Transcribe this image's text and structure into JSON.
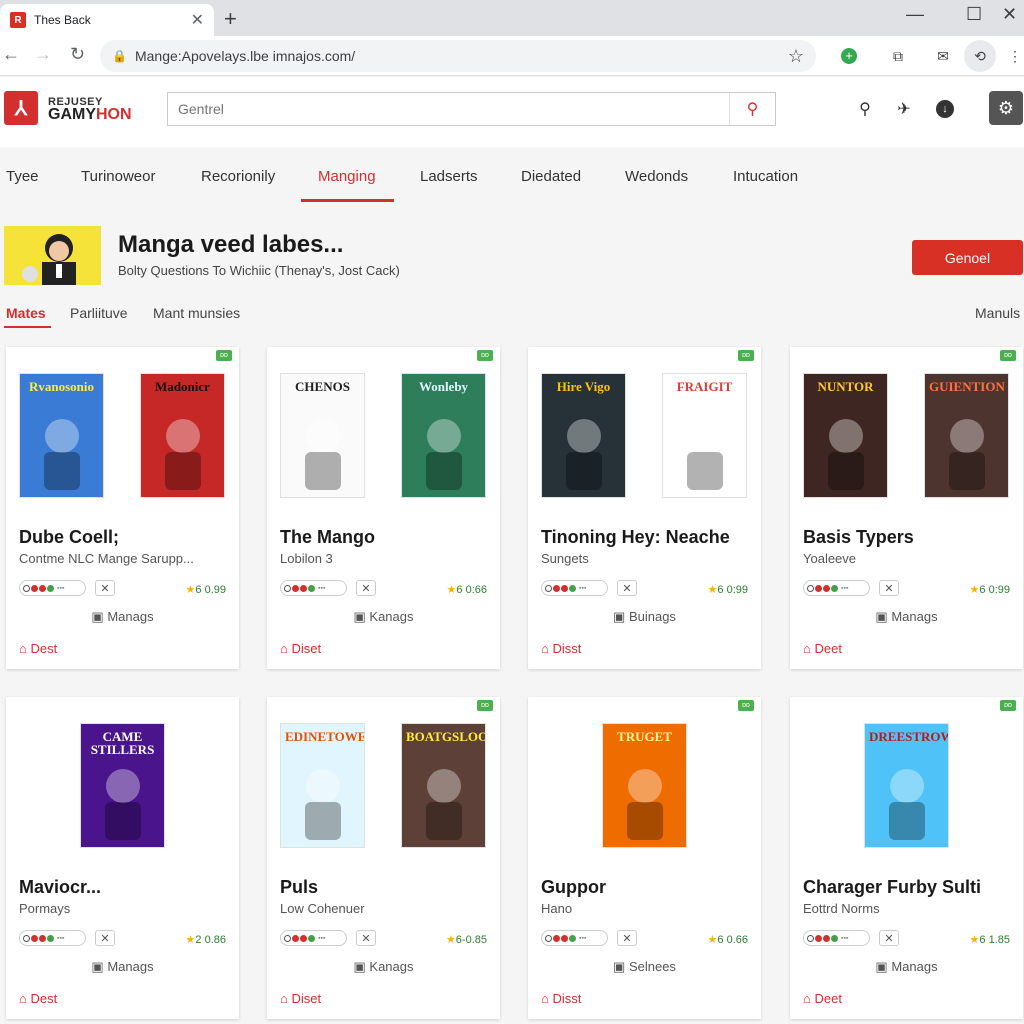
{
  "browser": {
    "tab_title": "Thes Back",
    "tab_icon": "r-logo-icon",
    "url": "Mange:Apovelays.lbe imnajos.com/"
  },
  "site": {
    "logo_top": "REJUSEY",
    "logo_bottom_a": "GAMY",
    "logo_bottom_b": "HON",
    "search_placeholder": "Gentrel",
    "brand_color": "#d32f2f"
  },
  "nav": {
    "items": [
      "Tyee",
      "Turinoweor",
      "Recorionily",
      "Manging",
      "Ladserts",
      "Diedated",
      "Wedonds",
      "Intucation"
    ],
    "active": "Manging"
  },
  "banner": {
    "title": "Manga veed labes...",
    "subtitle": "Bolty Questions To Wichiic (Thenay's, Jost Cack)",
    "cta": "Genoel"
  },
  "subtabs": {
    "items": [
      "Mates",
      "Parliituve",
      "Mant munsies"
    ],
    "right": "Manuls"
  },
  "cards": [
    {
      "title": "Dube Coell;",
      "subtitle": "Contme NLC Mange Sarupp...",
      "rating": "6 0.99",
      "meta": "Manags",
      "action": "Dest",
      "badge": "ᴅᴅ",
      "covers": [
        {
          "label": "Rvanosonio",
          "bg": "#3a7bd5",
          "fg": "#ffeb3b"
        },
        {
          "label": "Madonicr",
          "bg": "#c62828",
          "fg": "#111111"
        }
      ]
    },
    {
      "title": "The Mango",
      "subtitle": "Lobilon 3",
      "rating": "6 0:66",
      "meta": "Kanags",
      "action": "Diset",
      "badge": "ᴅᴅ",
      "covers": [
        {
          "label": "CHENOS",
          "bg": "#fafafa",
          "fg": "#222222"
        },
        {
          "label": "Wonleby",
          "bg": "#2e7d5b",
          "fg": "#e0f7fa"
        }
      ]
    },
    {
      "title": "Tinoning Hey: Neache",
      "subtitle": "Sungets",
      "rating": "6 0:99",
      "meta": "Buinags",
      "action": "Disst",
      "badge": "ᴅᴅ",
      "covers": [
        {
          "label": "Hire Vigo",
          "bg": "#263238",
          "fg": "#ffc107"
        },
        {
          "label": "FRAIGIT",
          "bg": "#ffffff",
          "fg": "#e53935"
        }
      ]
    },
    {
      "title": "Basis Typers",
      "subtitle": "Yoaleeve",
      "rating": "6 0:99",
      "meta": "Manags",
      "action": "Deet",
      "badge": "ᴅᴅ",
      "covers": [
        {
          "label": "NUNTOR",
          "bg": "#3e2723",
          "fg": "#ffca28"
        },
        {
          "label": "GUIENTION",
          "bg": "#4e342e",
          "fg": "#ff7043"
        }
      ]
    },
    {
      "title": "Maviocr...",
      "subtitle": "Pormays",
      "rating": "2 0.86",
      "meta": "Manags",
      "action": "Dest",
      "badge": "",
      "covers": [
        {
          "label": "CAME STILLERS",
          "bg": "#4a148c",
          "fg": "#ffffff"
        }
      ]
    },
    {
      "title": "Puls",
      "subtitle": "Low Cohenuer",
      "rating": "6-0.85",
      "meta": "Kanags",
      "action": "Diset",
      "badge": "ᴅᴅ",
      "covers": [
        {
          "label": "EDINETOWES",
          "bg": "#e1f5fe",
          "fg": "#e65100"
        },
        {
          "label": "BOATGSLOOTO",
          "bg": "#5d4037",
          "fg": "#ffeb3b"
        }
      ]
    },
    {
      "title": "Guppor",
      "subtitle": "Hano",
      "rating": "6 0.66",
      "meta": "Selnees",
      "action": "Disst",
      "badge": "ᴅᴅ",
      "covers": [
        {
          "label": "TRUGET",
          "bg": "#ef6c00",
          "fg": "#fff59d"
        }
      ]
    },
    {
      "title": "Charager Furby Sulti",
      "subtitle": "Eottrd Norms",
      "rating": "6 1.85",
      "meta": "Manags",
      "action": "Deet",
      "badge": "ᴅᴅ",
      "covers": [
        {
          "label": "DREESTROWEN",
          "bg": "#4fc3f7",
          "fg": "#b71c1c"
        }
      ]
    }
  ]
}
